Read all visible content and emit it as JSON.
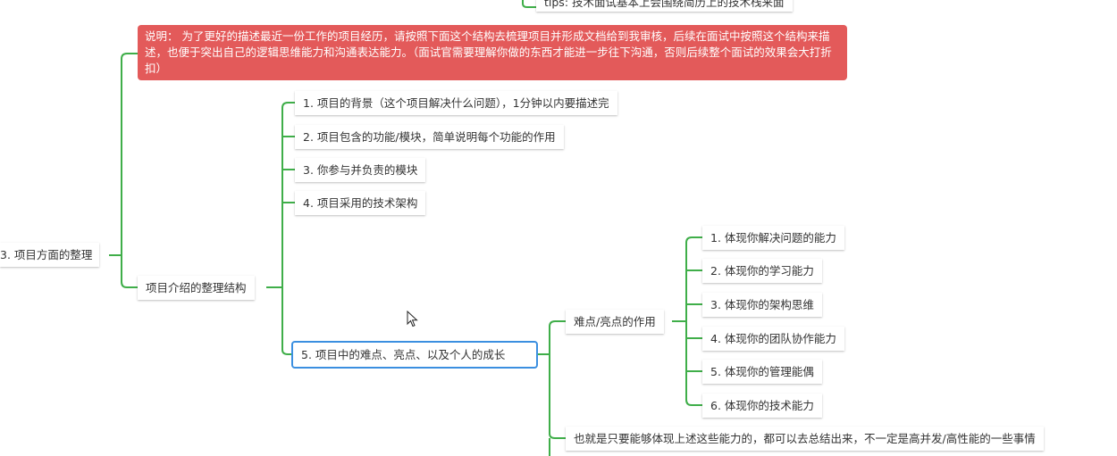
{
  "top_partial": {
    "text": "tips: 技术面试基本上会围绕简历上的技术栈来面"
  },
  "root": {
    "text": "3. 项目方面的整理"
  },
  "note": {
    "text": "说明：  为了更好的描述最近一份工作的项目经历，请按照下面这个结构去梳理项目并形成文档给到我审核，后续在面试中按照这个结构来描述，也便于突出自己的逻辑思维能力和沟通表达能力。（面试官需要理解你做的东西才能进一步往下沟通，否则后续整个面试的效果会大打折扣）"
  },
  "structure": {
    "text": "项目介绍的整理结构"
  },
  "items": [
    "1. 项目的背景（这个项目解决什么问题），1分钟以内要描述完",
    "2. 项目包含的功能/模块，简单说明每个功能的作用",
    "3. 你参与并负责的模块",
    "4. 项目采用的技术架构",
    "5. 项目中的难点、亮点、以及个人的成长"
  ],
  "highlight": {
    "text": "难点/亮点的作用"
  },
  "abilities": [
    "1. 体现你解决问题的能力",
    "2. 体现你的学习能力",
    "3. 体现你的架构思维",
    "4. 体现你的团队协作能力",
    "5. 体现你的管理能偶",
    "6. 体现你的技术能力"
  ],
  "summary": {
    "text": "也就是只要能够体现上述这些能力的，都可以去总结出来，不一定是高并发/高性能的一些事情"
  },
  "colors": {
    "branch": "#3fae49",
    "note_bg": "#e35a5a",
    "selected_border": "#3b8fe0"
  }
}
